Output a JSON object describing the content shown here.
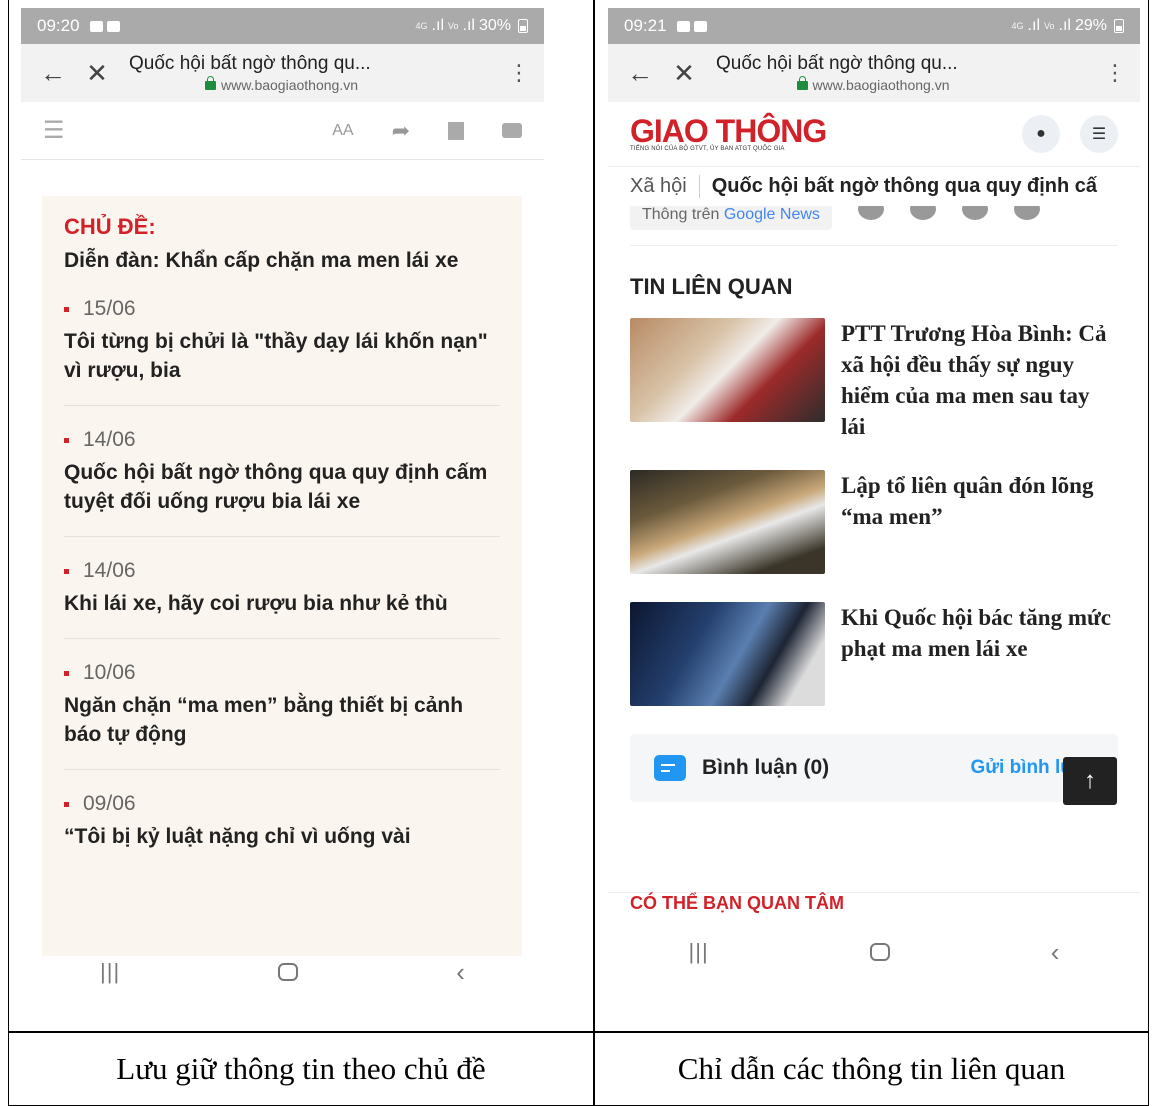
{
  "left": {
    "status": {
      "time": "09:20",
      "battery": "30%"
    },
    "url_bar": {
      "title": "Quốc hội bất ngờ thông qu...",
      "url": "www.baogiaothong.vn"
    },
    "topic": {
      "heading": "CHỦ ĐỀ:",
      "name": "Diễn đàn: Khẩn cấp chặn ma men lái xe",
      "items": [
        {
          "date": "15/06",
          "title": "Tôi từng bị chửi là \"thầy dạy lái khốn nạn\" vì rượu, bia"
        },
        {
          "date": "14/06",
          "title": "Quốc hội bất ngờ thông qua quy định cấm tuyệt đối uống rượu bia lái xe"
        },
        {
          "date": "14/06",
          "title": "Khi lái xe, hãy coi rượu bia như kẻ thù"
        },
        {
          "date": "10/06",
          "title": "Ngăn chặn “ma men” bằng thiết bị cảnh báo tự động"
        },
        {
          "date": "09/06",
          "title": "“Tôi bị kỷ luật nặng chỉ vì uống vài"
        }
      ]
    },
    "caption": "Lưu giữ thông tin theo chủ đề"
  },
  "right": {
    "status": {
      "time": "09:21",
      "battery": "29%"
    },
    "url_bar": {
      "title": "Quốc hội bất ngờ thông qu...",
      "url": "www.baogiaothong.vn"
    },
    "logo": {
      "text": "GIAO THÔNG",
      "tagline": "TIẾNG NÓI CỦA BỘ GTVT, ỦY BAN ATGT QUỐC GIA"
    },
    "breadcrumb": {
      "section": "Xã hội",
      "article": "Quốc hội bất ngờ thông qua quy định cấ"
    },
    "follow": {
      "prefix": "Thông trên",
      "brand": "Google News"
    },
    "related": {
      "heading": "TIN LIÊN QUAN",
      "items": [
        {
          "title": "PTT Trương Hòa Bình: Cả xã hội đều thấy sự nguy hiểm của ma men sau tay lái"
        },
        {
          "title": "Lập tổ liên quân đón lõng “ma men”"
        },
        {
          "title": "Khi Quốc hội bác tăng mức phạt ma men lái xe"
        }
      ]
    },
    "comments": {
      "label": "Bình luận (0)",
      "send": "Gửi bình luận"
    },
    "maybe_heading": "CÓ THỂ BẠN QUAN TÂM",
    "caption": "Chỉ dẫn các thông tin liên quan"
  },
  "icons": {
    "back": "←",
    "close": "✕",
    "more": "⋮",
    "menu": "☰",
    "text_size": "AA",
    "share": "➦",
    "to_top": "↑",
    "recents": "|||",
    "nav_back": "‹"
  },
  "colors": {
    "brand_red": "#d1222a",
    "link_blue": "#2196f3",
    "topic_bg": "#faf5ee",
    "status_bar": "#aaaaaa"
  }
}
